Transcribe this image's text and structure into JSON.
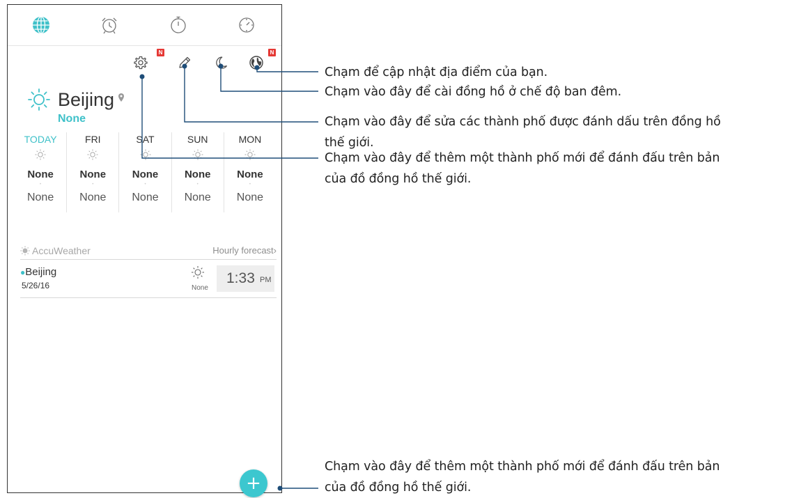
{
  "colors": {
    "accent": "#3fc1c9",
    "badge": "#e53935",
    "fab": "#3cc7cf",
    "leader": "#1e4d78"
  },
  "tabs": [
    {
      "name": "world-clock",
      "icon": "globe-icon",
      "active": true
    },
    {
      "name": "alarm",
      "icon": "alarm-clock-icon",
      "active": false
    },
    {
      "name": "stopwatch",
      "icon": "stopwatch-icon",
      "active": false
    },
    {
      "name": "timer",
      "icon": "timer-icon",
      "active": false
    }
  ],
  "toolbar": {
    "settings": {
      "icon": "gear-icon",
      "badge": "N"
    },
    "edit": {
      "icon": "pencil-icon"
    },
    "night_mode": {
      "icon": "moon-icon"
    },
    "location": {
      "icon": "globe-location-icon",
      "badge": "N"
    }
  },
  "weather": {
    "city": "Beijing",
    "condition": "None",
    "forecast": [
      {
        "day": "TODAY",
        "condition": "None",
        "low": "None"
      },
      {
        "day": "FRI",
        "condition": "None",
        "low": "None"
      },
      {
        "day": "SAT",
        "condition": "None",
        "low": "None"
      },
      {
        "day": "SUN",
        "condition": "None",
        "low": "None"
      },
      {
        "day": "MON",
        "condition": "None",
        "low": "None"
      }
    ],
    "provider": "AccuWeather",
    "hourly_link": "Hourly forecast"
  },
  "world_clock": {
    "city": "Beijing",
    "date": "5/26/16",
    "condition": "None",
    "time": "1:33",
    "ampm": "PM"
  },
  "fab": {
    "label": "+"
  },
  "callouts": {
    "location": "Chạm để cập nhật địa điểm của bạn.",
    "night_mode": "Chạm vào đây để cài đồng hồ ở chế độ ban đêm.",
    "edit_line1": "Chạm vào đây để sửa các thành phố được đánh dấu trên đồng hồ",
    "edit_line2": "thế giới.",
    "settings_line1": "Chạm vào đây để thêm một thành phố mới để đánh đấu trên bản",
    "settings_line2": "của đồ đồng hồ thế giới.",
    "fab_line1": "Chạm vào đây để thêm một thành phố mới để đánh đấu trên bản",
    "fab_line2": "của đồ đồng hồ thế giới."
  }
}
